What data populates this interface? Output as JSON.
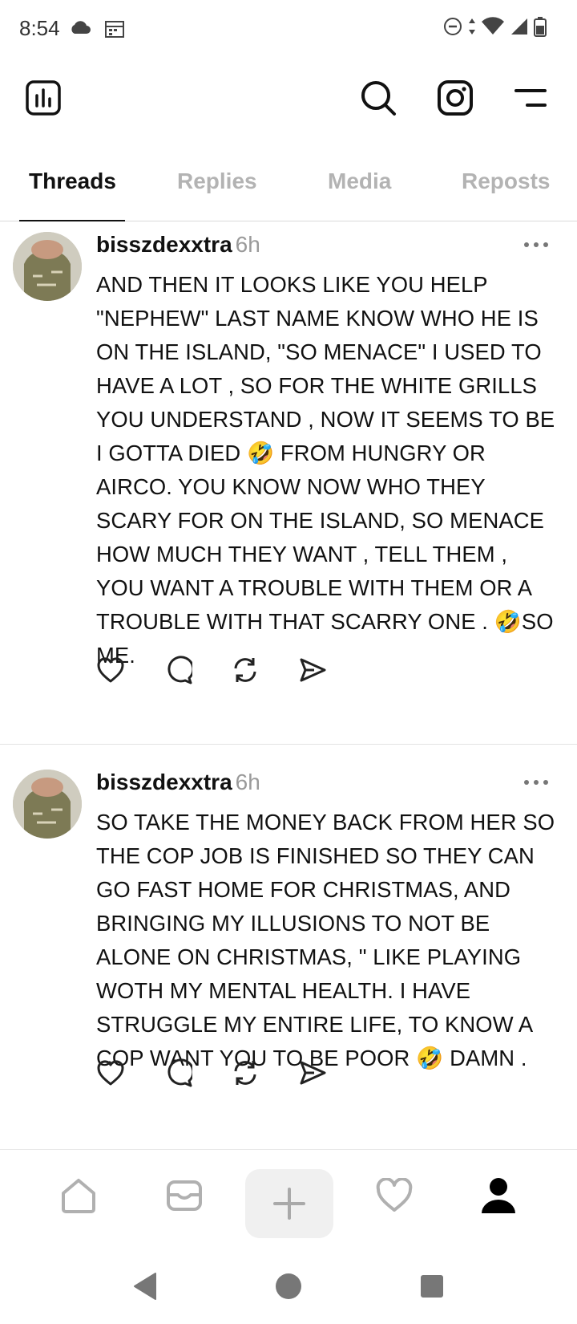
{
  "status_bar": {
    "time": "8:54",
    "icons": [
      "cloud-icon",
      "calendar-icon",
      "dnd-icon",
      "data-arrows-icon",
      "wifi-icon",
      "signal-icon",
      "battery-icon"
    ]
  },
  "header": {
    "icons": [
      "insights-icon",
      "search-icon",
      "instagram-icon",
      "menu-icon"
    ]
  },
  "tabs": [
    {
      "label": "Threads",
      "active": true
    },
    {
      "label": "Replies",
      "active": false
    },
    {
      "label": "Media",
      "active": false
    },
    {
      "label": "Reposts",
      "active": false
    }
  ],
  "posts": [
    {
      "username": "bisszdexxtra",
      "time": "6h",
      "text": "AND THEN IT LOOKS LIKE YOU HELP\n\"NEPHEW\" LAST NAME KNOW WHO HE IS\nON THE ISLAND, \"SO MENACE\" I USED TO\nHAVE A LOT , SO  FOR THE WHITE GRILLS\nYOU UNDERSTAND , NOW IT SEEMS TO BE\nI GOTTA DIED 🤣 FROM HUNGRY OR\nAIRCO.  YOU KNOW NOW WHO THEY\nSCARY FOR ON THE ISLAND, SO MENACE\nHOW MUCH THEY WANT , TELL THEM ,\nYOU WANT A TROUBLE WITH THEM OR A\nTROUBLE WITH THAT SCARRY ONE . 🤣SO\nME."
    },
    {
      "username": "bisszdexxtra",
      "time": "6h",
      "text": "SO TAKE THE MONEY BACK FROM HER SO\nTHE COP JOB IS FINISHED SO THEY CAN\nGO FAST HOME FOR CHRISTMAS, AND\nBRINGING MY ILLUSIONS TO NOT BE\nALONE ON CHRISTMAS, \" LIKE PLAYING\nWOTH MY MENTAL HEALTH. I HAVE\nSTRUGGLE MY ENTIRE LIFE, TO KNOW A\nCOP WANT YOU TO BE POOR 🤣 DAMN ."
    }
  ],
  "post_actions": [
    "heart-icon",
    "comment-icon",
    "repost-icon",
    "share-icon"
  ],
  "bottom_nav": [
    "home-icon",
    "inbox-icon",
    "new-thread-icon",
    "activity-icon",
    "profile-icon"
  ],
  "system_nav": [
    "back-icon",
    "home-circle-icon",
    "recents-icon"
  ]
}
